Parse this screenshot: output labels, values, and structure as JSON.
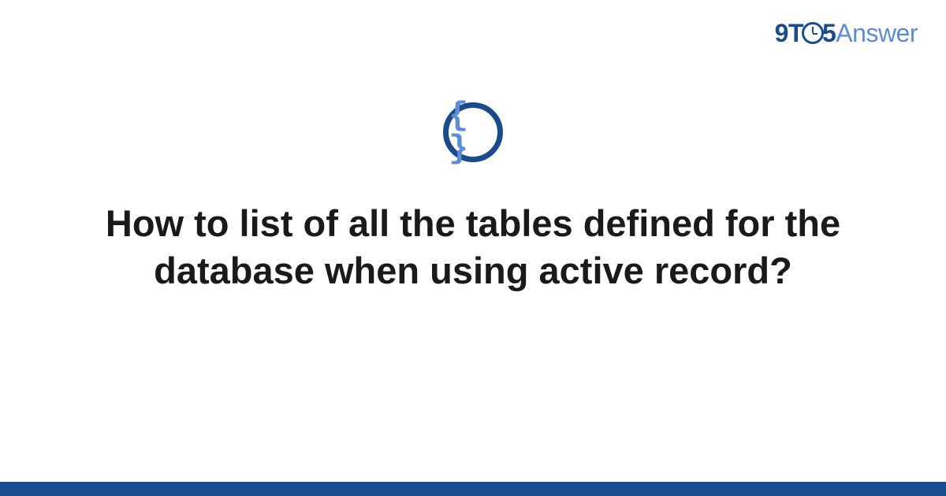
{
  "brand": {
    "part1": "9T",
    "part2": "5",
    "part3": "Answer"
  },
  "category": {
    "icon_name": "code-braces-icon",
    "glyph": "{ }"
  },
  "question": {
    "title": "How to list of all the tables defined for the database when using active record?"
  },
  "colors": {
    "brand_dark": "#1a4b8c",
    "brand_light": "#5b8dd6"
  }
}
